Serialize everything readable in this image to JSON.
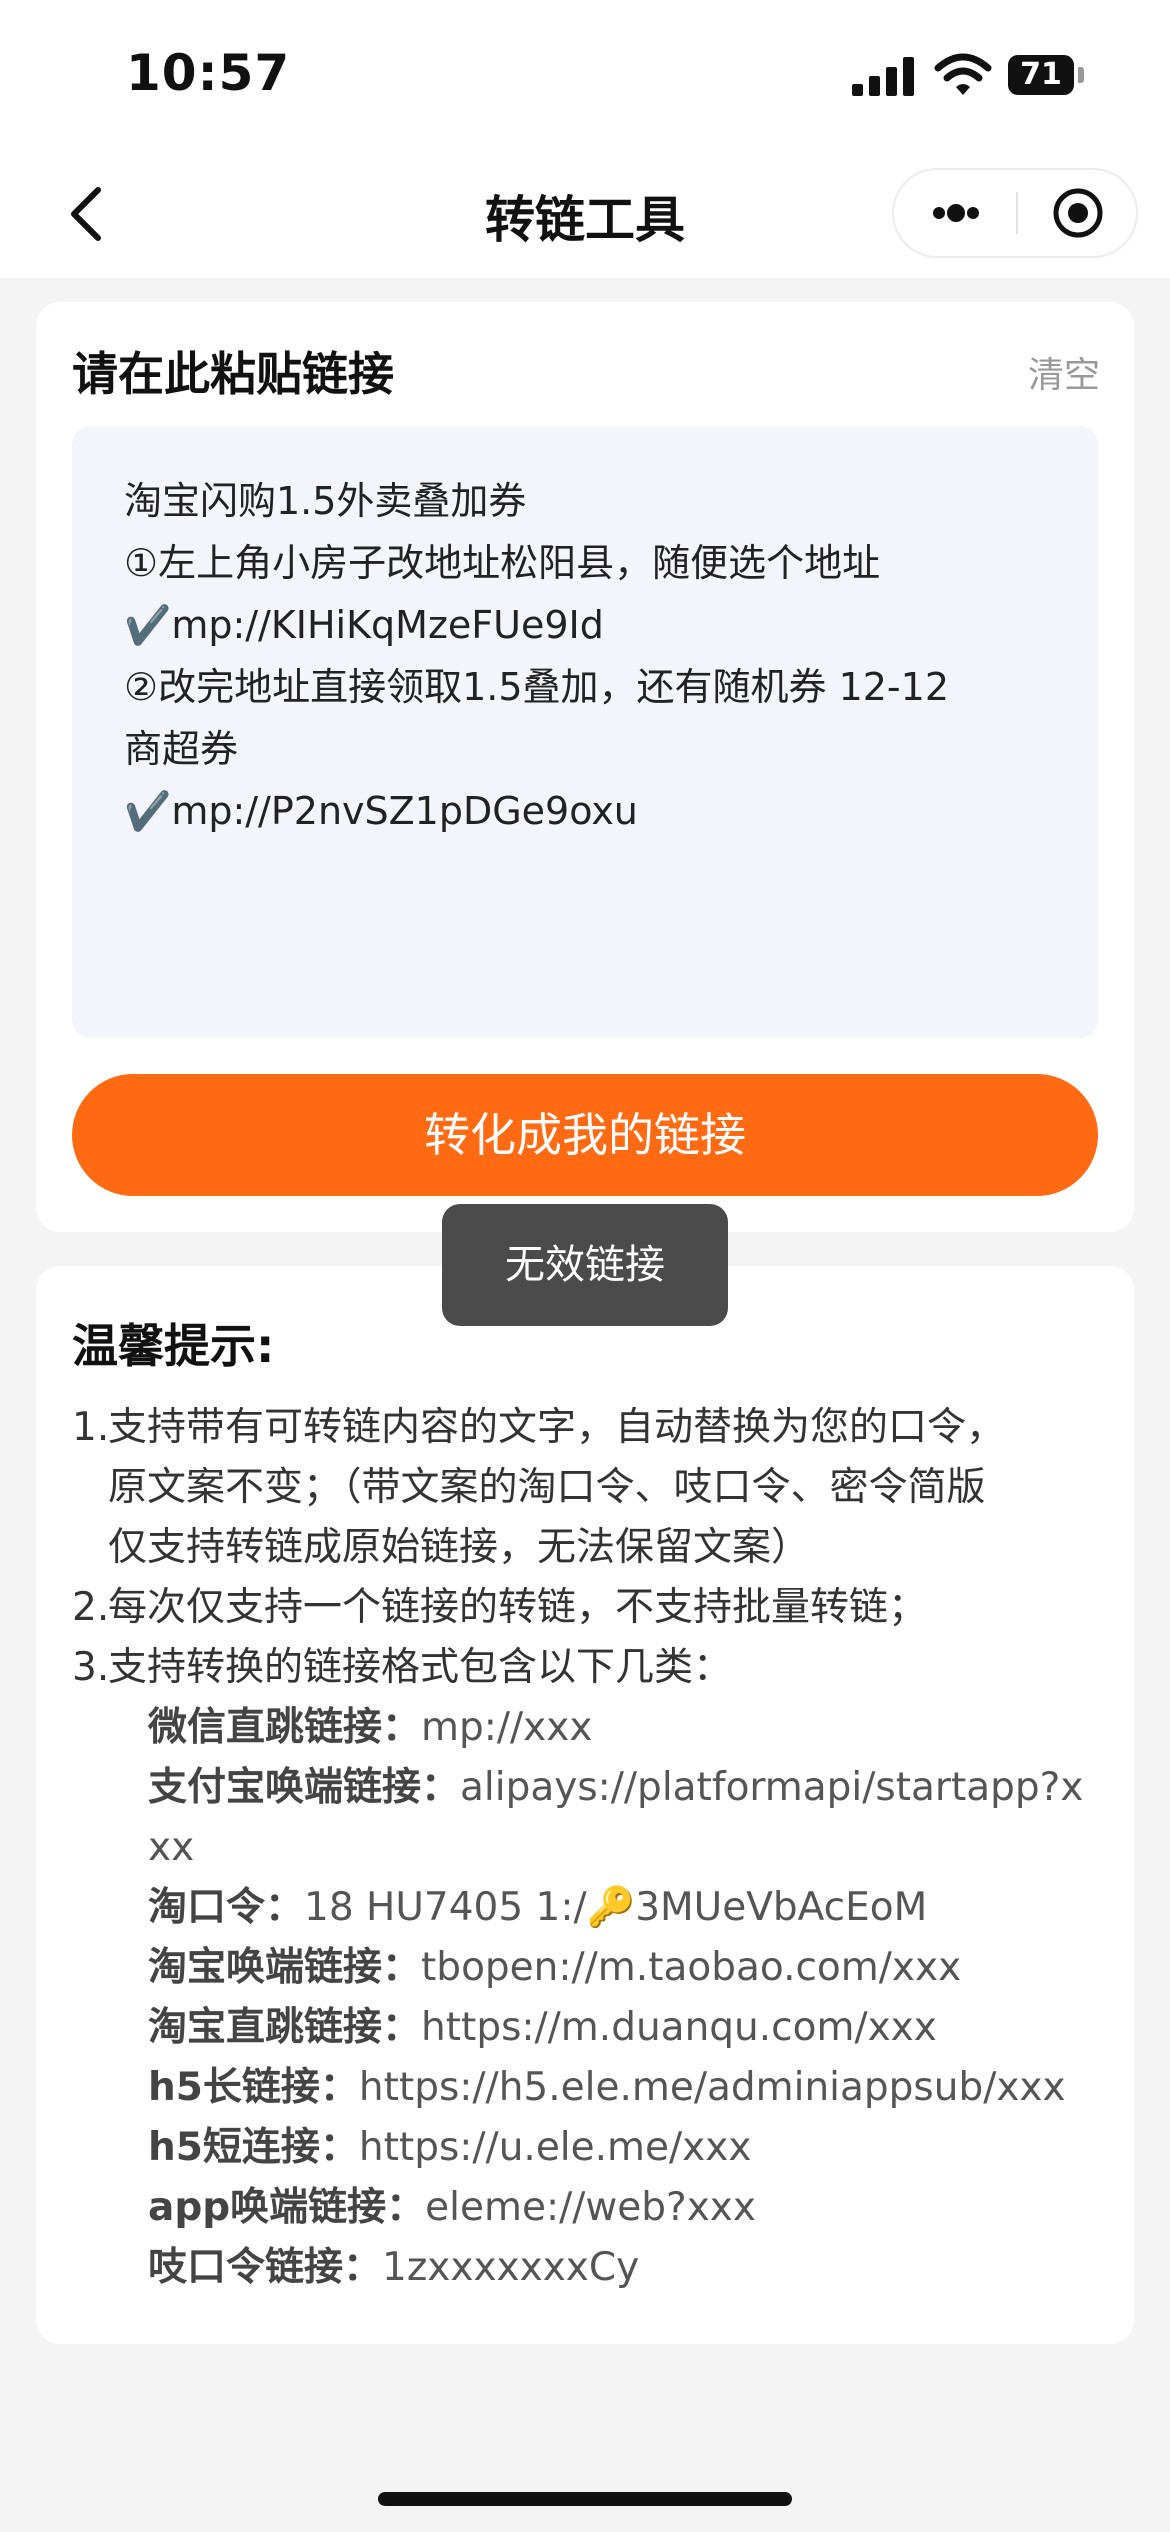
{
  "status_bar": {
    "time": "10:57",
    "battery": "71"
  },
  "nav": {
    "title": "转链工具"
  },
  "input_card": {
    "label": "请在此粘贴链接",
    "clear": "清空",
    "content_lines": [
      "淘宝闪购1.5外卖叠加券",
      "①左上角小房子改地址松阳县，随便选个地址",
      "✔️mp://KIHiKqMzeFUe9Id",
      "②改完地址直接领取1.5叠加，还有随机券 12-12",
      "商超券",
      "✔️mp://P2nvSZ1pDGe9oxu"
    ],
    "convert_button": "转化成我的链接"
  },
  "toast": "无效链接",
  "tips": {
    "title": "温馨提示:",
    "items": [
      {
        "num": "1.",
        "lines": [
          "支持带有可转链内容的文字，自动替换为您的口令，",
          "原文案不变；（带文案的淘口令、吱口令、密令简版",
          "仅支持转链成原始链接，无法保留文案）"
        ]
      },
      {
        "num": "2.",
        "lines": [
          "每次仅支持一个链接的转链，不支持批量转链；"
        ]
      },
      {
        "num": "3.",
        "lines": [
          "支持转换的链接格式包含以下几类："
        ]
      }
    ],
    "formats": [
      {
        "key": "微信直跳链接：",
        "value": "mp://xxx"
      },
      {
        "key": "支付宝唤端链接：",
        "value": "alipays://platformapi/startapp?x"
      },
      {
        "key": "",
        "value": "xx"
      },
      {
        "key": "淘口令：",
        "value": "18 HU7405 1:/🔑3MUeVbAcEoM"
      },
      {
        "key": "淘宝唤端链接：",
        "value": "tbopen://m.taobao.com/xxx"
      },
      {
        "key": "淘宝直跳链接：",
        "value": "https://m.duanqu.com/xxx"
      },
      {
        "key": "h5长链接：",
        "value": "https://h5.ele.me/adminiappsub/xxx"
      },
      {
        "key": "h5短连接：",
        "value": "https://u.ele.me/xxx"
      },
      {
        "key": "app唤端链接：",
        "value": "eleme://web?xxx"
      },
      {
        "key": "吱口令链接：",
        "value": "1zxxxxxxxCy"
      }
    ]
  },
  "colors": {
    "accent": "#ff6a13",
    "toast_bg": "#4b4b4b",
    "page_bg": "#f4f4f4"
  }
}
